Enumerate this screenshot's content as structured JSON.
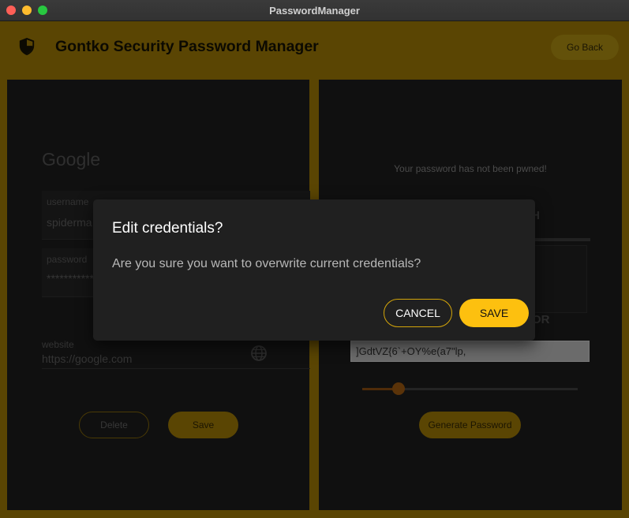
{
  "window": {
    "title": "PasswordManager"
  },
  "appbar": {
    "title": "Gontko Security Password Manager",
    "go_back_label": "Go Back",
    "icon": "shield-icon"
  },
  "left_panel": {
    "site_title": "Google",
    "username": {
      "label": "username",
      "value": "spiderma"
    },
    "password": {
      "label": "password",
      "value": "***********"
    },
    "website": {
      "label": "website",
      "value": "https://google.com",
      "icon": "globe-icon"
    },
    "delete_label": "Delete",
    "save_label": "Save"
  },
  "right_panel": {
    "pwned_status": "Your password has not been pwned!",
    "strength_header_fragment": "TH",
    "generator_header_fragment": "OR",
    "generated_password": "]GdtVZ{6`+OY%e(a7\"lp,",
    "length_slider_fraction": 0.17,
    "generate_label": "Generate Password"
  },
  "dialog": {
    "title": "Edit credentials?",
    "message": "Are you sure you want to overwrite current credentials?",
    "cancel_label": "CANCEL",
    "save_label": "SAVE"
  },
  "colors": {
    "accent": "#fdc00f",
    "appbar_dimmed": "#5a4503",
    "panel_bg": "#101010",
    "dialog_bg": "#202020"
  }
}
